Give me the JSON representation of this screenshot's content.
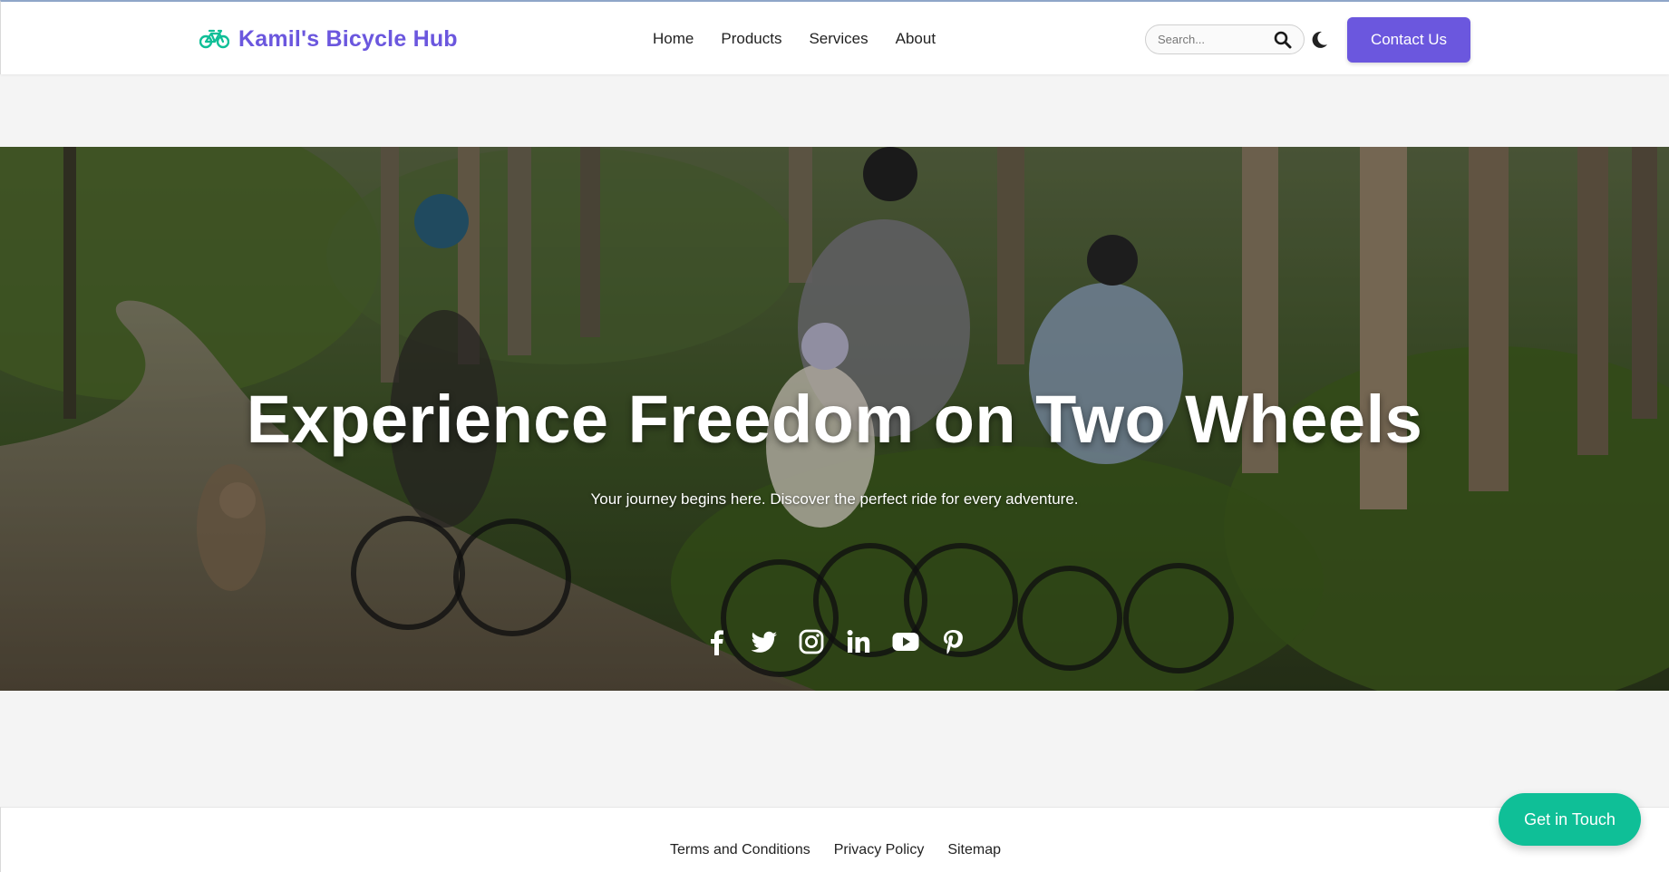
{
  "header": {
    "brand_name": "Kamil's Bicycle Hub",
    "brand_icon": "bicycle-icon",
    "nav": [
      {
        "label": "Home"
      },
      {
        "label": "Products"
      },
      {
        "label": "Services"
      },
      {
        "label": "About"
      }
    ],
    "search": {
      "placeholder": "Search...",
      "value": "",
      "icon": "search-icon"
    },
    "theme_toggle_icon": "moon-icon",
    "contact_label": "Contact Us"
  },
  "hero": {
    "title": "Experience Freedom on Two Wheels",
    "subtitle": "Your journey begins here. Discover the perfect ride for every adventure.",
    "social_icons": [
      "facebook-icon",
      "twitter-icon",
      "instagram-icon",
      "linkedin-icon",
      "youtube-icon",
      "pinterest-icon"
    ]
  },
  "footer": {
    "links": [
      {
        "label": "Terms and Conditions"
      },
      {
        "label": "Privacy Policy"
      },
      {
        "label": "Sitemap"
      }
    ]
  },
  "floating_button": {
    "label": "Get in Touch"
  },
  "colors": {
    "brand": "#6b57de",
    "accent": "#0fbf97",
    "background": "#f4f4f4"
  }
}
